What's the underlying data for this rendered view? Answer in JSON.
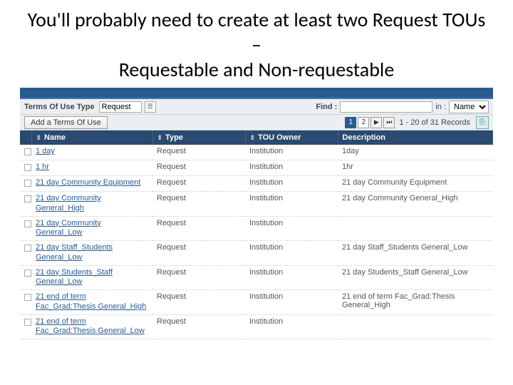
{
  "title_line1": "You'll probably need to create at least two Request TOUs –",
  "title_line2": "Requestable and Non-requestable",
  "toolbar": {
    "tou_type_label": "Terms Of Use Type",
    "tou_type_value": "Request",
    "find_label": "Find :",
    "find_value": "",
    "in_label": "in :",
    "in_selected": "Name",
    "add_button": "Add a Terms Of Use",
    "pager": {
      "pages": [
        "1",
        "2"
      ],
      "current": "1",
      "records_text": "1 - 20 of 31 Records"
    }
  },
  "columns": [
    "Name",
    "Type",
    "TOU Owner",
    "Description"
  ],
  "rows": [
    {
      "name": "1 day",
      "type": "Request",
      "owner": "Institution",
      "desc": "1day"
    },
    {
      "name": "1 hr",
      "type": "Request",
      "owner": "Institution",
      "desc": "1hr"
    },
    {
      "name": "21 day Community Equipment",
      "type": "Request",
      "owner": "Institution",
      "desc": "21 day Community Equipment"
    },
    {
      "name": "21 day Community General_High",
      "type": "Request",
      "owner": "Institution",
      "desc": "21 day Community General_High"
    },
    {
      "name": "21 day Community General_Low",
      "type": "Request",
      "owner": "Institution",
      "desc": ""
    },
    {
      "name": "21 day Staff_Students General_Low",
      "type": "Request",
      "owner": "Institution",
      "desc": "21 day Staff_Students General_Low"
    },
    {
      "name": "21 day Students_Staff General_Low",
      "type": "Request",
      "owner": "Institution",
      "desc": "21 day Students_Staff General_Low"
    },
    {
      "name": "21 end of term Fac_Grad:Thesis General_High",
      "type": "Request",
      "owner": "Institution",
      "desc": "21 end of term Fac_Grad:Thesis General_High"
    },
    {
      "name": "21 end of term Fac_Grad:Thesis General_Low",
      "type": "Request",
      "owner": "Institution",
      "desc": ""
    }
  ]
}
